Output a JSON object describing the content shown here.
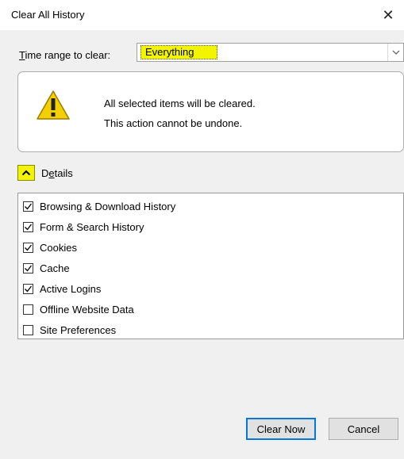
{
  "window": {
    "title": "Clear All History",
    "close_glyph": "✕"
  },
  "time_range": {
    "label_accel": "T",
    "label_rest": "ime range to clear:",
    "selected": "Everything"
  },
  "warning": {
    "icon": "warning-triangle-icon",
    "line1": "All selected items will be cleared.",
    "line2": "This action cannot be undone."
  },
  "details": {
    "label_first": "D",
    "label_accel": "e",
    "label_rest": "tails",
    "expanded": true,
    "items": [
      {
        "label": "Browsing & Download History",
        "checked": true
      },
      {
        "label": "Form & Search History",
        "checked": true
      },
      {
        "label": "Cookies",
        "checked": true
      },
      {
        "label": "Cache",
        "checked": true
      },
      {
        "label": "Active Logins",
        "checked": true
      },
      {
        "label": "Offline Website Data",
        "checked": false
      },
      {
        "label": "Site Preferences",
        "checked": false
      }
    ]
  },
  "buttons": {
    "clear_now": "Clear Now",
    "cancel": "Cancel"
  },
  "colors": {
    "highlight": "#f3f500",
    "focus_border": "#0078d7",
    "warning_fill": "#f5d000"
  }
}
